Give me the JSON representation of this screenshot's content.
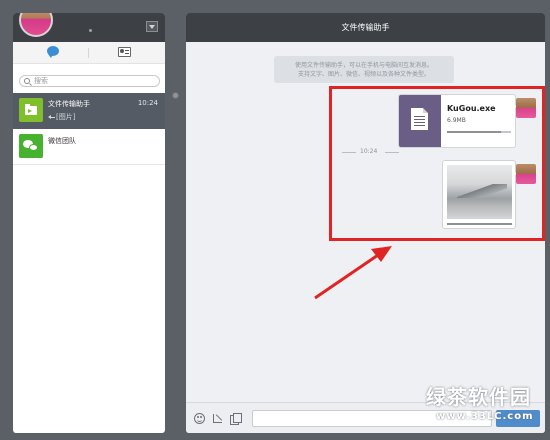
{
  "sidebar": {
    "search": {
      "placeholder": "搜索"
    },
    "conversations": [
      {
        "name": "文件传输助手",
        "time": "10:24",
        "preview": "[图片]",
        "selected": true
      },
      {
        "name": "微信团队",
        "time": "",
        "preview": "",
        "selected": false
      }
    ]
  },
  "chat": {
    "title": "文件传输助手",
    "notice_line1": "使用文件传输助手，可以在手机与电脑间互发消息。",
    "notice_line2": "支持文字、图片、微信、视频以及各种文件类型。",
    "file_message": {
      "name": "KuGou.exe",
      "size": "6.9MB",
      "progress": 0.85
    },
    "time_divider": "10:24",
    "image_message": {
      "progress": 1.0
    }
  },
  "watermark": {
    "title": "绿茶软件园",
    "url": "www.33LC.com"
  },
  "colors": {
    "highlight": "#e02424",
    "selected_row": "#545b64",
    "header": "#3d4146",
    "file_icon_bg": "#6b5e86",
    "send_button": "#4f8ccc"
  }
}
